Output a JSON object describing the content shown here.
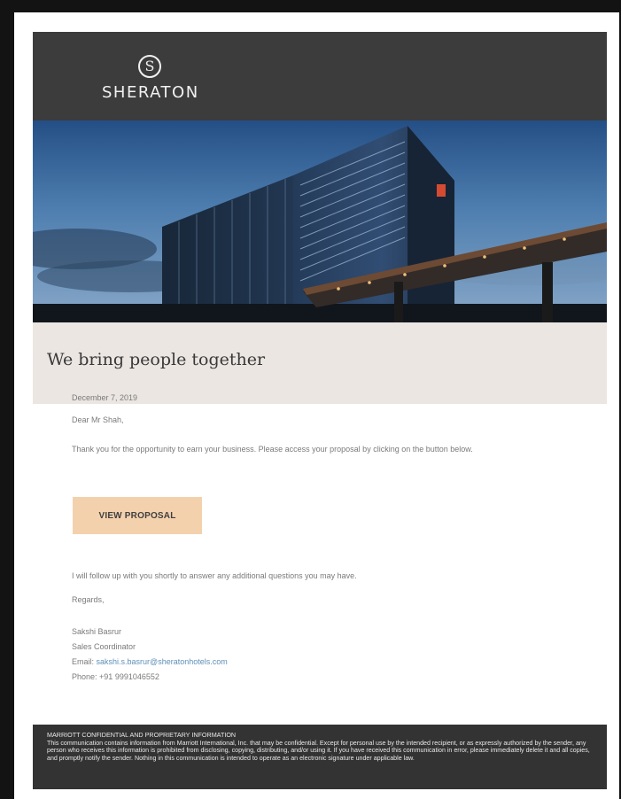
{
  "brand": {
    "logo_letter": "S",
    "name": "SHERATON"
  },
  "hero": {
    "accent": "#d54b32"
  },
  "tagline": "We bring people together",
  "email": {
    "date": "December 7, 2019",
    "salutation": "Dear Mr Shah,",
    "intro": "Thank you for the opportunity to earn your business. Please access your proposal by clicking on the button below.",
    "cta_label": "VIEW PROPOSAL",
    "followup": "I will follow up with you shortly to answer any additional questions you may have.",
    "regards": "Regards,"
  },
  "signature": {
    "name": "Sakshi Basrur",
    "title": "Sales Coordinator",
    "email_label": "Email:",
    "email": "sakshi.s.basrur@sheratonhotels.com",
    "phone_label": "Phone:",
    "phone": "+91 9991046552"
  },
  "footer": {
    "title": "MARRIOTT CONFIDENTIAL AND PROPRIETARY INFORMATION",
    "text": "This communication contains information from Marriott International, Inc. that may be confidential. Except for personal use by the intended recipient, or as expressly authorized by the sender, any person who receives this information is prohibited from disclosing, copying, distributing, and/or using it. If you have received this communication in error, please immediately delete it and all copies, and promptly notify the sender. Nothing in this communication is intended to operate as an electronic signature under applicable law."
  }
}
